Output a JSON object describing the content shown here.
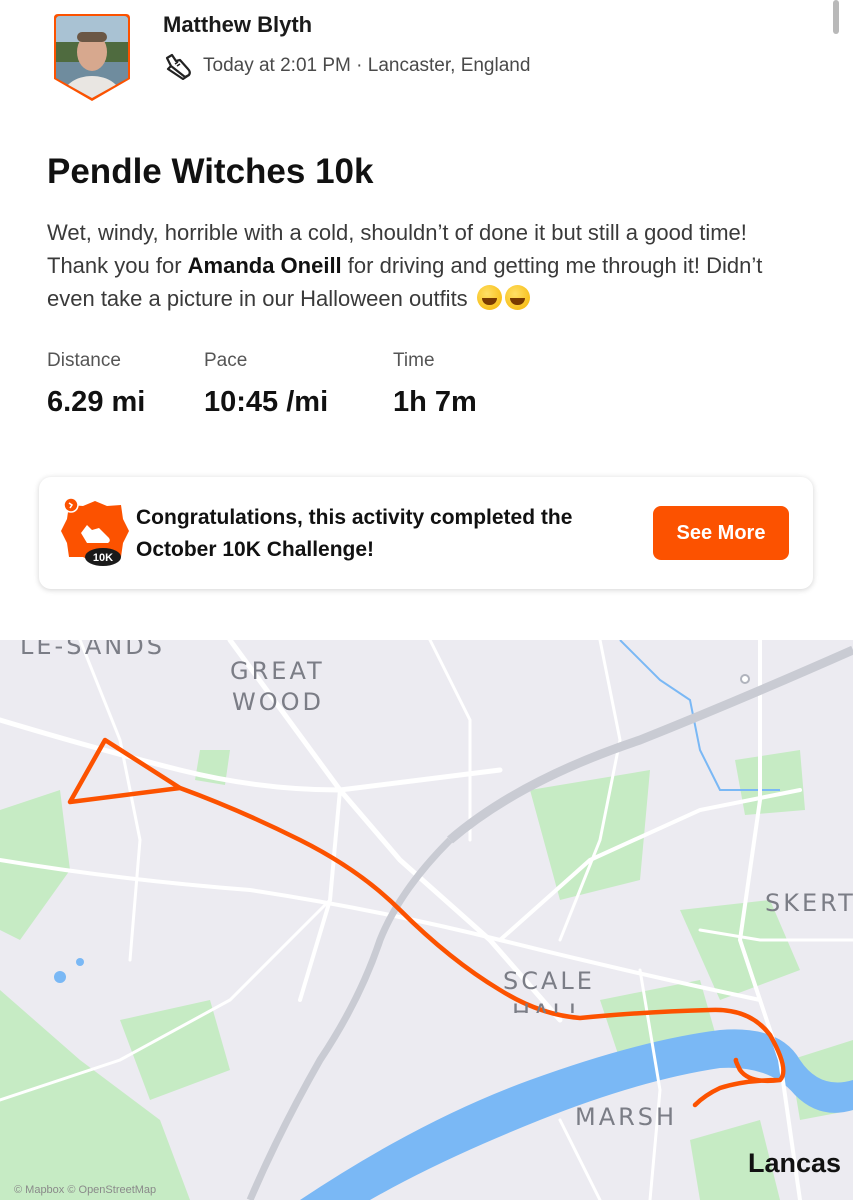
{
  "header": {
    "athlete_name": "Matthew Blyth",
    "timestamp_location": "Today at 2:01 PM · Lancaster, England",
    "activity_icon": "running-shoe-icon"
  },
  "activity": {
    "title": "Pendle Witches 10k",
    "description_part1": "Wet, windy, horrible with a cold, shouldn’t of done it but still a good time! Thank you for ",
    "mention": "Amanda Oneill",
    "description_part2": " for driving and getting me through it! Didn’t even take a picture in our Halloween outfits",
    "emoji": "rolling-on-floor-laughing-emoji"
  },
  "stats": [
    {
      "label": "Distance",
      "value": "6.29 mi"
    },
    {
      "label": "Pace",
      "value": "10:45 /mi"
    },
    {
      "label": "Time",
      "value": "1h 7m"
    }
  ],
  "challenge": {
    "badge_label": "10K",
    "text": "Congratulations, this activity completed the October 10K Challenge!",
    "button_label": "See More"
  },
  "map": {
    "labels": {
      "le_sands": "LE-SANDS",
      "great": "GREAT",
      "wood": "WOOD",
      "skert": "SKERT",
      "scale": "SCALE",
      "hall": "HALL",
      "marsh": "MARSH",
      "lancas": "Lancas"
    },
    "attribution": "© Mapbox © OpenStreetMap",
    "route_color": "#fc5200",
    "water_color": "#7ab8f5",
    "park_color": "#c6ebc4"
  },
  "colors": {
    "accent": "#fc5200"
  }
}
